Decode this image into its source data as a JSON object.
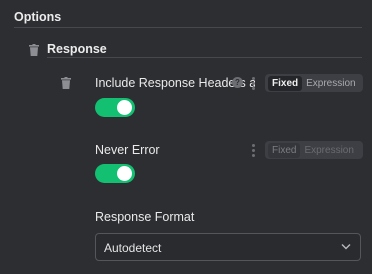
{
  "options": {
    "title": "Options",
    "response_group": {
      "title": "Response",
      "include_headers": {
        "label": "Include Response Headers and Status",
        "help": "?",
        "mode_fixed": "Fixed",
        "mode_expression": "Expression",
        "enabled": true
      },
      "never_error": {
        "label": "Never Error",
        "mode_fixed": "Fixed",
        "mode_expression": "Expression",
        "enabled": true
      },
      "response_format": {
        "label": "Response Format",
        "value": "Autodetect"
      }
    }
  },
  "colors": {
    "toggle_on": "#13c072",
    "background": "#2d2e32"
  },
  "icons": {
    "delete": "trash-icon",
    "options": "vertical-dots-icon",
    "dropdown": "chevron-down-icon"
  }
}
